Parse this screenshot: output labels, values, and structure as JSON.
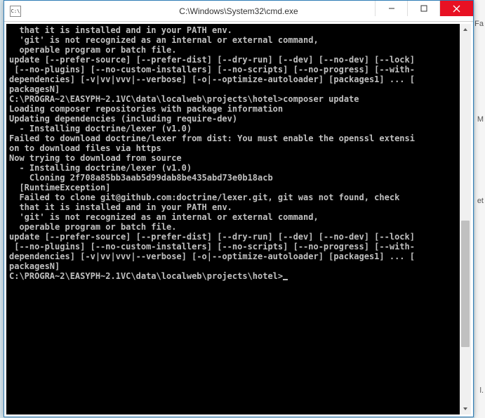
{
  "window": {
    "title": "C:\\Windows\\System32\\cmd.exe",
    "icon_text": "C:\\"
  },
  "console": {
    "lines": [
      "  that it is installed and in your PATH env.",
      "",
      "  'git' is not recognized as an internal or external command,",
      "  operable program or batch file.",
      "",
      "",
      "",
      "",
      "update [--prefer-source] [--prefer-dist] [--dry-run] [--dev] [--no-dev] [--lock]",
      " [--no-plugins] [--no-custom-installers] [--no-scripts] [--no-progress] [--with-",
      "dependencies] [-v|vv|vvv|--verbose] [-o|--optimize-autoloader] [packages1] ... [",
      "packagesN]",
      "",
      "",
      "C:\\PROGRA~2\\EASYPH~2.1VC\\data\\localweb\\projects\\hotel>composer update",
      "Loading composer repositories with package information",
      "Updating dependencies (including require-dev)",
      "  - Installing doctrine/lexer (v1.0)",
      "Failed to download doctrine/lexer from dist: You must enable the openssl extensi",
      "on to download files via https",
      "Now trying to download from source",
      "  - Installing doctrine/lexer (v1.0)",
      "    Cloning 2f708a85bb3aab5d99dab8be435abd73e0b18acb",
      "",
      "",
      "",
      "  [RuntimeException]",
      "  Failed to clone git@github.com:doctrine/lexer.git, git was not found, check",
      "  that it is installed and in your PATH env.",
      "",
      "  'git' is not recognized as an internal or external command,",
      "  operable program or batch file.",
      "",
      "",
      "",
      "",
      "update [--prefer-source] [--prefer-dist] [--dry-run] [--dev] [--no-dev] [--lock]",
      " [--no-plugins] [--no-custom-installers] [--no-scripts] [--no-progress] [--with-",
      "dependencies] [-v|vv|vvv|--verbose] [-o|--optimize-autoloader] [packages1] ... [",
      "packagesN]",
      "",
      "",
      "C:\\PROGRA~2\\EASYPH~2.1VC\\data\\localweb\\projects\\hotel>"
    ]
  },
  "bg_fragments": [
    "Fa",
    "M",
    "et",
    "l."
  ]
}
